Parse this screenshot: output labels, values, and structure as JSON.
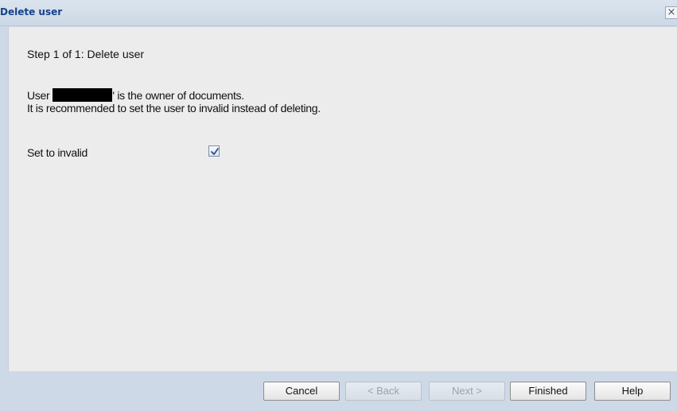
{
  "window": {
    "title": "Delete user",
    "close_glyph": "×"
  },
  "wizard": {
    "step_title": "Step 1 of 1: Delete user",
    "message_prefix": "User",
    "message_suffix": "' is the owner of documents.",
    "recommendation": "It is recommended to set the user to invalid instead of deleting.",
    "set_invalid_label": "Set to invalid",
    "set_invalid_checked": true
  },
  "buttons": {
    "cancel": "Cancel",
    "back": "< Back",
    "next": "Next >",
    "finished": "Finished",
    "help": "Help"
  },
  "colors": {
    "title_text": "#15428b",
    "frame": "#ced9e7",
    "content_bg": "#ececec"
  }
}
